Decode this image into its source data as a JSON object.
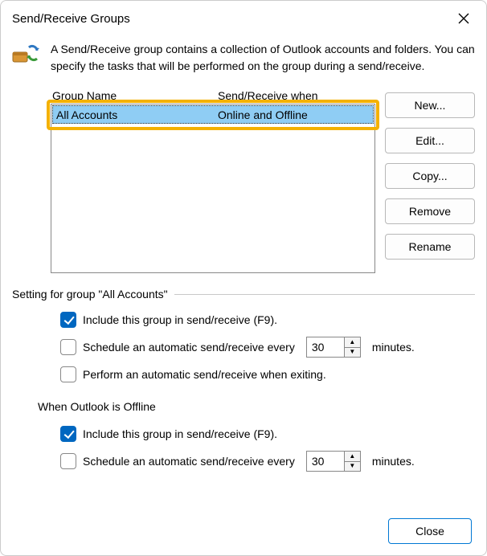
{
  "window": {
    "title": "Send/Receive Groups"
  },
  "intro": "A Send/Receive group contains a collection of Outlook accounts and folders. You can specify the tasks that will be performed on the group during a send/receive.",
  "columns": {
    "name": "Group Name",
    "when": "Send/Receive when"
  },
  "rows": [
    {
      "name": "All Accounts",
      "when": "Online and Offline"
    }
  ],
  "buttons": {
    "new": "New...",
    "edit": "Edit...",
    "copy": "Copy...",
    "remove": "Remove",
    "rename": "Rename",
    "close": "Close"
  },
  "section_label": "Setting for group \"All Accounts\"",
  "online": {
    "include": "Include this group in send/receive (F9).",
    "schedule": "Schedule an automatic send/receive every",
    "mins_value": "30",
    "mins_suffix": "minutes.",
    "exit": "Perform an automatic send/receive when exiting."
  },
  "offline_heading": "When Outlook is Offline",
  "offline": {
    "include": "Include this group in send/receive (F9).",
    "schedule": "Schedule an automatic send/receive every",
    "mins_value": "30",
    "mins_suffix": "minutes."
  }
}
